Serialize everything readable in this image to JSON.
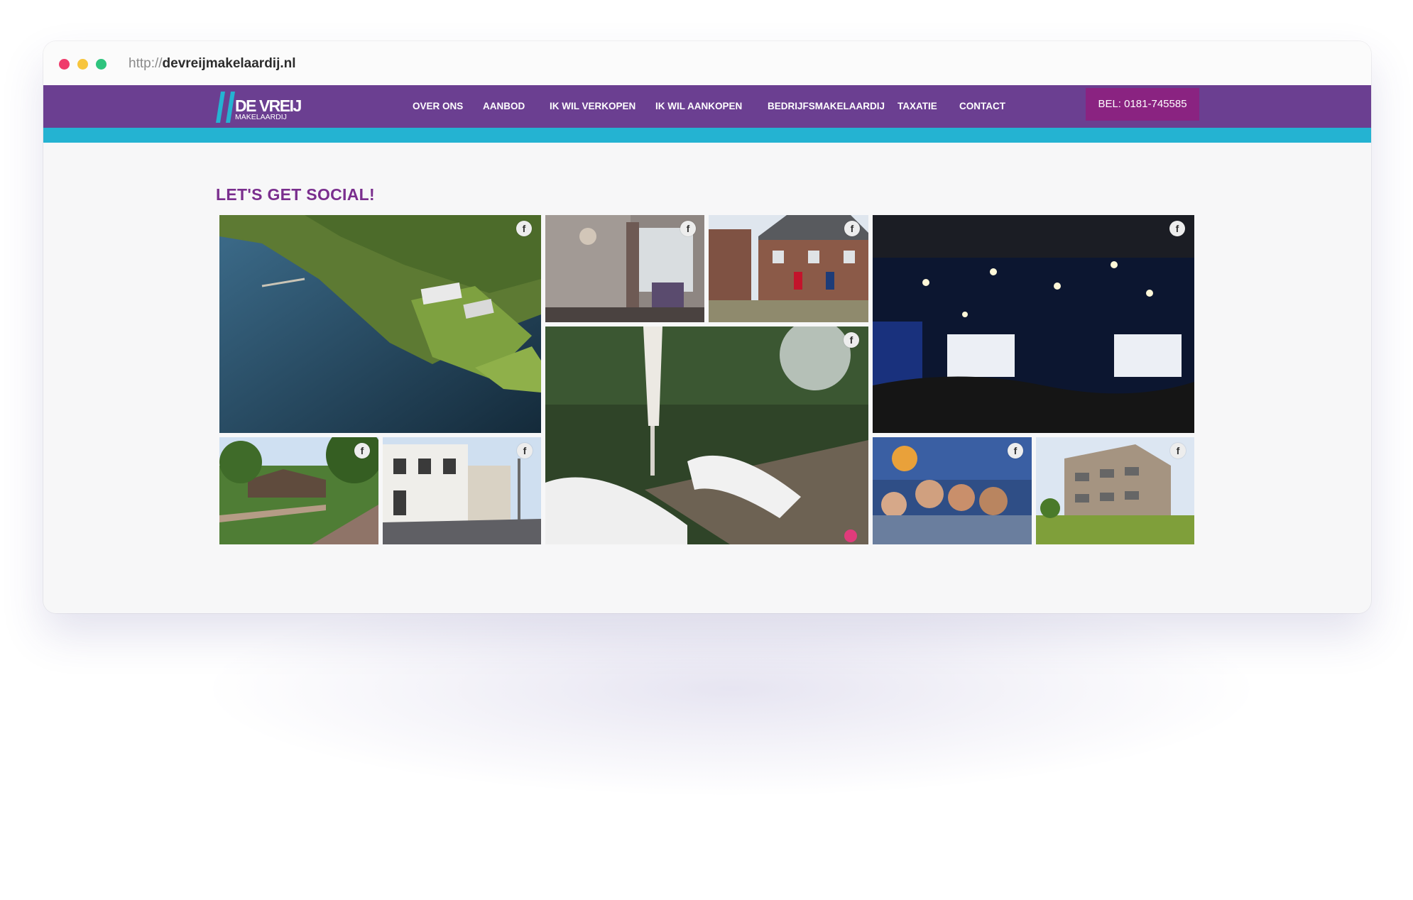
{
  "browser": {
    "url_protocol": "http://",
    "url_domain": "devreijmakelaardij.nl"
  },
  "header": {
    "logo_title": "DE VREIJ",
    "logo_subtitle": "MAKELAARDIJ",
    "menu": [
      {
        "label": "OVER ONS"
      },
      {
        "label": "AANBOD"
      },
      {
        "label": "IK WIL VERKOPEN"
      },
      {
        "label": "IK WIL AANKOPEN"
      },
      {
        "label": "BEDRIJFSMAKELAARDIJ"
      },
      {
        "label": "TAXATIE"
      },
      {
        "label": "CONTACT"
      }
    ],
    "call_label": "BEL: 0181-745585"
  },
  "social": {
    "title": "LET'S GET SOCIAL!",
    "fb_glyph": "f",
    "photos": [
      {
        "name": "aerial-lakeside-villa-photo",
        "icon": "facebook-icon"
      },
      {
        "name": "hotel-room-interior-photo",
        "icon": "facebook-icon"
      },
      {
        "name": "brick-row-houses-photo",
        "icon": "facebook-icon"
      },
      {
        "name": "conference-hall-photo",
        "icon": "facebook-icon"
      },
      {
        "name": "garden-lounge-chairs-photo",
        "icon": "facebook-icon"
      },
      {
        "name": "bungalow-street-photo",
        "icon": "facebook-icon"
      },
      {
        "name": "white-townhouse-street-photo",
        "icon": "facebook-icon"
      },
      {
        "name": "festival-selfie-photo",
        "icon": "facebook-icon"
      },
      {
        "name": "apartment-building-photo",
        "icon": "facebook-icon"
      }
    ]
  },
  "colors": {
    "nav_bg": "#6b3f91",
    "accent": "#24b3d2",
    "call_button": "#8a2381",
    "title": "#7a2e8e"
  }
}
